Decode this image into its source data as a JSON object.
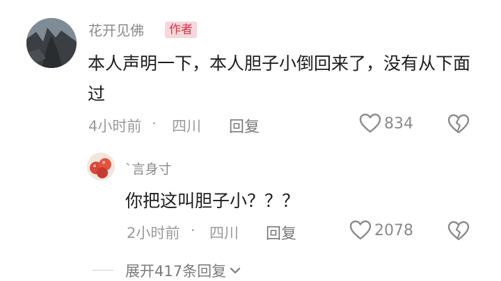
{
  "comment": {
    "author": "花开见佛",
    "badge": "作者",
    "text": "本人声明一下，本人胆子小倒回来了，没有从下面过",
    "time": "4小时前",
    "separator": "·",
    "location": "四川",
    "reply_label": "回复",
    "likes": "834",
    "like_icon": "heart-outline-icon",
    "dislike_icon": "broken-heart-icon"
  },
  "reply": {
    "author": "`言身寸",
    "text": "你把这叫胆子小？？？",
    "time": "2小时前",
    "separator": "·",
    "location": "四川",
    "reply_label": "回复",
    "likes": "2078",
    "like_icon": "heart-outline-icon",
    "dislike_icon": "broken-heart-icon"
  },
  "expand": {
    "label": "展开417条回复",
    "icon": "chevron-down-icon"
  }
}
